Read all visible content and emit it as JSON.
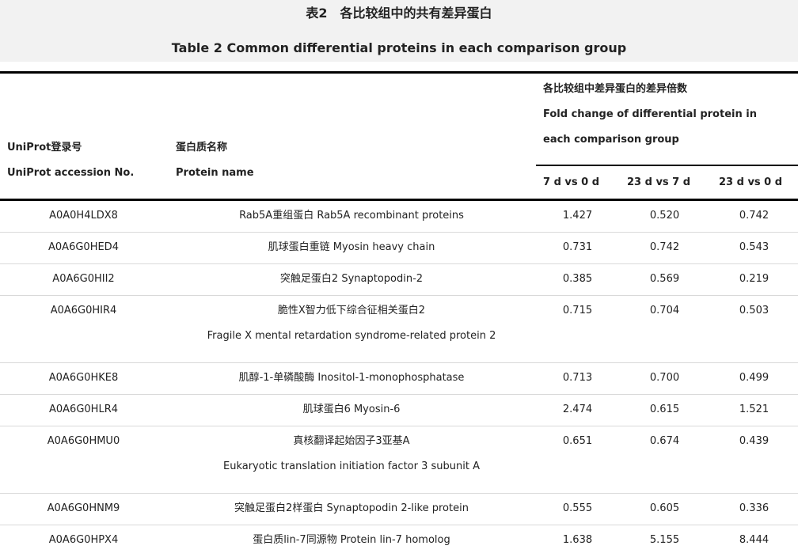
{
  "caption": {
    "zh": "表2　各比较组中的共有差异蛋白",
    "en": "Table 2  Common differential proteins in each comparison group"
  },
  "header": {
    "acc_zh": "UniProt登录号",
    "acc_en": "UniProt accession No.",
    "name_zh": "蛋白质名称",
    "name_en": "Protein name",
    "fc_zh": "各比较组中差异蛋白的差异倍数",
    "fc_en_1": "Fold change of differential protein in",
    "fc_en_2": "each comparison group",
    "sub": [
      "7 d vs 0 d",
      "23 d vs 7 d",
      "23 d vs 0 d"
    ]
  },
  "rows": [
    {
      "acc": "A0A0H4LDX8",
      "name": "Rab5A重组蛋白 Rab5A recombinant proteins",
      "name2": "",
      "v1": "1.427",
      "v2": "0.520",
      "v3": "0.742"
    },
    {
      "acc": "A0A6G0HED4",
      "name": "肌球蛋白重链 Myosin heavy chain",
      "name2": "",
      "v1": "0.731",
      "v2": "0.742",
      "v3": "0.543"
    },
    {
      "acc": "A0A6G0HII2",
      "name": "突触足蛋白2 Synaptopodin-2",
      "name2": "",
      "v1": "0.385",
      "v2": "0.569",
      "v3": "0.219"
    },
    {
      "acc": "A0A6G0HIR4",
      "name": "脆性X智力低下综合征相关蛋白2",
      "name2": "Fragile X mental retardation syndrome-related protein 2",
      "v1": "0.715",
      "v2": "0.704",
      "v3": "0.503"
    },
    {
      "acc": "A0A6G0HKE8",
      "name": "肌醇-1-单磷酸酶 Inositol-1-monophosphatase",
      "name2": "",
      "v1": "0.713",
      "v2": "0.700",
      "v3": "0.499"
    },
    {
      "acc": "A0A6G0HLR4",
      "name": "肌球蛋白6 Myosin-6",
      "name2": "",
      "v1": "2.474",
      "v2": "0.615",
      "v3": "1.521"
    },
    {
      "acc": "A0A6G0HMU0",
      "name": "真核翻译起始因子3亚基A",
      "name2": "Eukaryotic translation initiation factor 3 subunit A",
      "v1": "0.651",
      "v2": "0.674",
      "v3": "0.439"
    },
    {
      "acc": "A0A6G0HNM9",
      "name": "突触足蛋白2样蛋白 Synaptopodin 2-like protein",
      "name2": "",
      "v1": "0.555",
      "v2": "0.605",
      "v3": "0.336"
    },
    {
      "acc": "A0A6G0HPX4",
      "name": "蛋白质lin-7同源物 Protein lin-7 homolog",
      "name2": "",
      "v1": "1.638",
      "v2": "5.155",
      "v3": "8.444"
    }
  ]
}
